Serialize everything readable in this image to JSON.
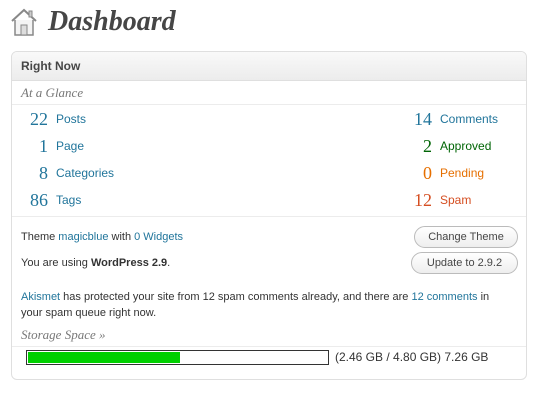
{
  "header": {
    "title": "Dashboard",
    "icon": "home-icon"
  },
  "widget": {
    "title": "Right Now",
    "at_a_glance": "At a Glance",
    "content_stats": [
      {
        "count": "22",
        "label": "Posts"
      },
      {
        "count": "1",
        "label": "Page"
      },
      {
        "count": "8",
        "label": "Categories"
      },
      {
        "count": "86",
        "label": "Tags"
      }
    ],
    "discussion_stats": [
      {
        "count": "14",
        "label": "Comments",
        "color": "#21759b"
      },
      {
        "count": "2",
        "label": "Approved",
        "color": "#006505"
      },
      {
        "count": "0",
        "label": "Pending",
        "color": "#e66f00"
      },
      {
        "count": "12",
        "label": "Spam",
        "color": "#d54e21"
      }
    ],
    "theme": {
      "prefix": "Theme ",
      "name": "magicblue",
      "middle": " with ",
      "widgets_link": "0 Widgets",
      "button": "Change Theme"
    },
    "version": {
      "prefix": "You are using ",
      "name": "WordPress 2.9",
      "suffix": ".",
      "button": "Update to 2.9.2"
    },
    "akismet": {
      "link": "Akismet",
      "text1": " has protected your site from 12 spam comments already, and there are ",
      "queue_link": "12 comments",
      "text2": " in your spam queue right now."
    },
    "storage": {
      "label": "Storage Space »",
      "used_fraction": 0.51,
      "bar_color": "#00d000",
      "summary": "(2.46 GB / 4.80 GB) 7.26 GB"
    }
  }
}
